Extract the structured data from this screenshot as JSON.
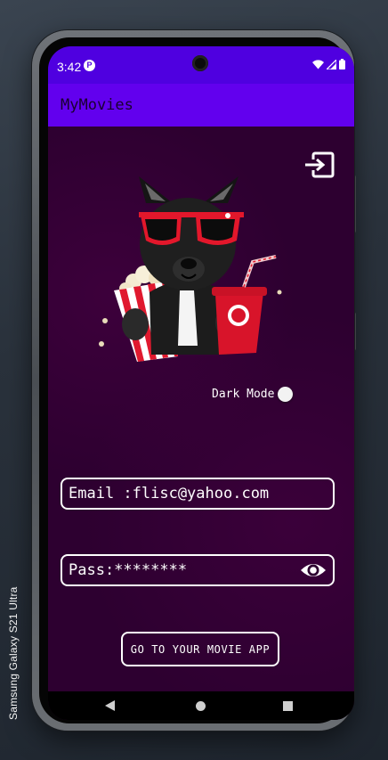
{
  "device": {
    "label": "Samsung Galaxy S21 Ultra"
  },
  "status_bar": {
    "time": "3:42",
    "app_icon": "P",
    "icons": [
      "wifi-icon",
      "signal-icon",
      "battery-icon"
    ]
  },
  "app_bar": {
    "title": "MyMovies"
  },
  "main": {
    "logout_icon": "logout-icon",
    "mascot": "french-bulldog-with-popcorn-and-soda",
    "dark_mode": {
      "label": "Dark Mode",
      "enabled": false
    },
    "email_field": {
      "value": "Email :flisc@yahoo.com"
    },
    "password_field": {
      "value": "Pass:********",
      "toggle_icon": "eye-icon"
    },
    "go_button": {
      "label": "GO TO YOUR MOVIE APP"
    }
  },
  "nav_bar": {
    "items": [
      "back-icon",
      "home-icon",
      "recent-apps-icon"
    ]
  },
  "colors": {
    "status_bar": "#4f00e0",
    "app_bar": "#6200ee",
    "background": "#2d0030",
    "text": "#ffffff"
  }
}
